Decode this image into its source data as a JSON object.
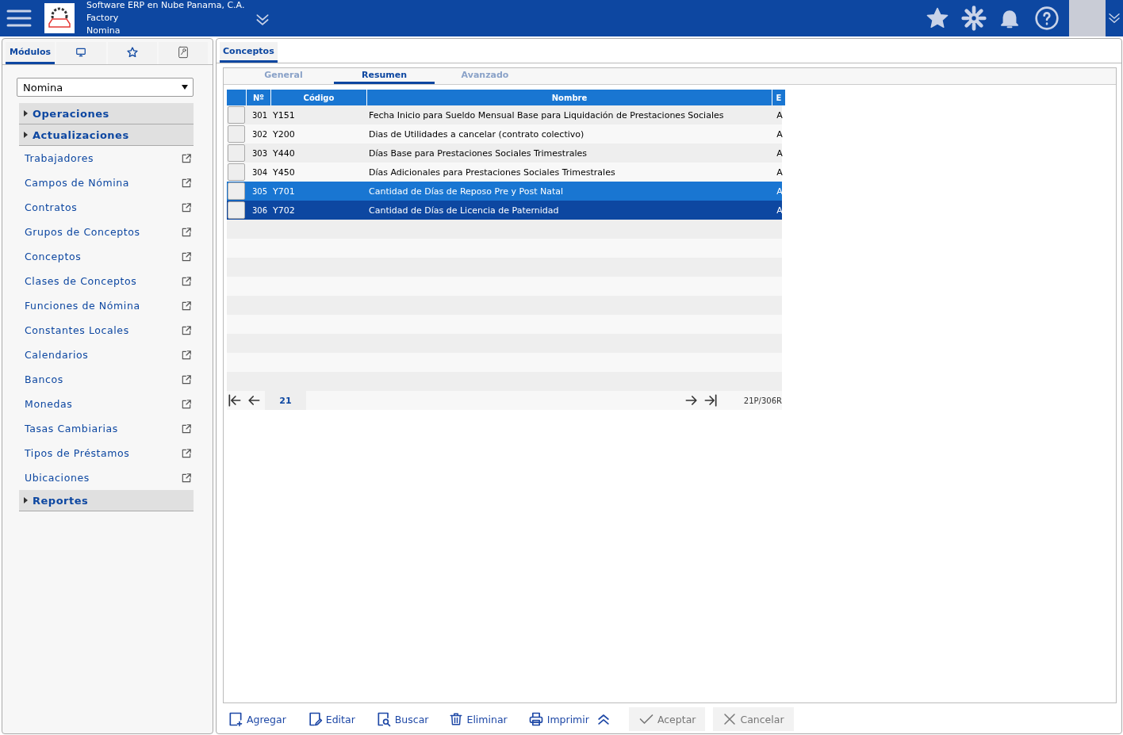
{
  "header": {
    "company": "Software ERP en Nube Panama, C.A.",
    "site": "Factory",
    "module": "Nomina"
  },
  "sidebar": {
    "tabs": [
      {
        "label": "Módulos",
        "selected": true
      },
      {
        "selected": false
      },
      {
        "selected": false
      },
      {
        "selected": false
      }
    ],
    "module_select": {
      "value": "Nomina"
    },
    "items": [
      {
        "kind": "group",
        "label": "Operaciones"
      },
      {
        "kind": "group",
        "label": "Actualizaciones"
      },
      {
        "kind": "link",
        "label": "Trabajadores"
      },
      {
        "kind": "link",
        "label": "Campos de Nómina"
      },
      {
        "kind": "link",
        "label": "Contratos"
      },
      {
        "kind": "link",
        "label": "Grupos de Conceptos"
      },
      {
        "kind": "link",
        "label": "Conceptos"
      },
      {
        "kind": "link",
        "label": "Clases de Conceptos"
      },
      {
        "kind": "link",
        "label": "Funciones de Nómina"
      },
      {
        "kind": "link",
        "label": "Constantes Locales"
      },
      {
        "kind": "link",
        "label": "Calendarios"
      },
      {
        "kind": "link",
        "label": "Bancos"
      },
      {
        "kind": "link",
        "label": "Monedas"
      },
      {
        "kind": "link",
        "label": "Tasas Cambiarias"
      },
      {
        "kind": "link",
        "label": "Tipos de Préstamos"
      },
      {
        "kind": "link",
        "label": "Ubicaciones"
      },
      {
        "kind": "group",
        "label": "Reportes"
      }
    ]
  },
  "main": {
    "tab": "Conceptos",
    "view_tabs": [
      {
        "label": "General",
        "selected": false
      },
      {
        "label": "Resumen",
        "selected": true
      },
      {
        "label": "Avanzado",
        "selected": false
      }
    ],
    "table": {
      "columns": [
        "Nº",
        "Código",
        "Nombre",
        "E"
      ],
      "rows": [
        {
          "no": "301",
          "code": "Y151",
          "name": "Fecha Inicio para Sueldo Mensual Base para Liquidación de Prestaciones Sociales",
          "e": "A",
          "selected": false,
          "hovered": false
        },
        {
          "no": "302",
          "code": "Y200",
          "name": "Dias de Utilidades a cancelar (contrato colectivo)",
          "e": "A",
          "selected": false,
          "hovered": false
        },
        {
          "no": "303",
          "code": "Y440",
          "name": "Días Base para Prestaciones Sociales Trimestrales",
          "e": "A",
          "selected": false,
          "hovered": false
        },
        {
          "no": "304",
          "code": "Y450",
          "name": "Días Adicionales para Prestaciones Sociales Trimestrales",
          "e": "A",
          "selected": false,
          "hovered": false
        },
        {
          "no": "305",
          "code": "Y701",
          "name": "Cantidad de Días de Reposo Pre y Post Natal",
          "e": "A",
          "selected": false,
          "hovered": true
        },
        {
          "no": "306",
          "code": "Y702",
          "name": "Cantidad de Días de Licencia de Paternidad",
          "e": "A",
          "selected": true,
          "hovered": false
        }
      ]
    },
    "pager": {
      "page": "21",
      "summary": "21P/306R"
    },
    "actions": [
      {
        "kind": "add",
        "label": "Agregar",
        "disabled": false
      },
      {
        "kind": "edit",
        "label": "Editar",
        "disabled": false
      },
      {
        "kind": "search",
        "label": "Buscar",
        "disabled": false
      },
      {
        "kind": "delete",
        "label": "Eliminar",
        "disabled": false
      },
      {
        "kind": "print",
        "label": "Imprimir",
        "disabled": false
      },
      {
        "kind": "collapse",
        "disabled": false
      },
      {
        "kind": "accept",
        "label": "Aceptar",
        "disabled": true
      },
      {
        "kind": "cancel",
        "label": "Cancelar",
        "disabled": true
      }
    ]
  }
}
